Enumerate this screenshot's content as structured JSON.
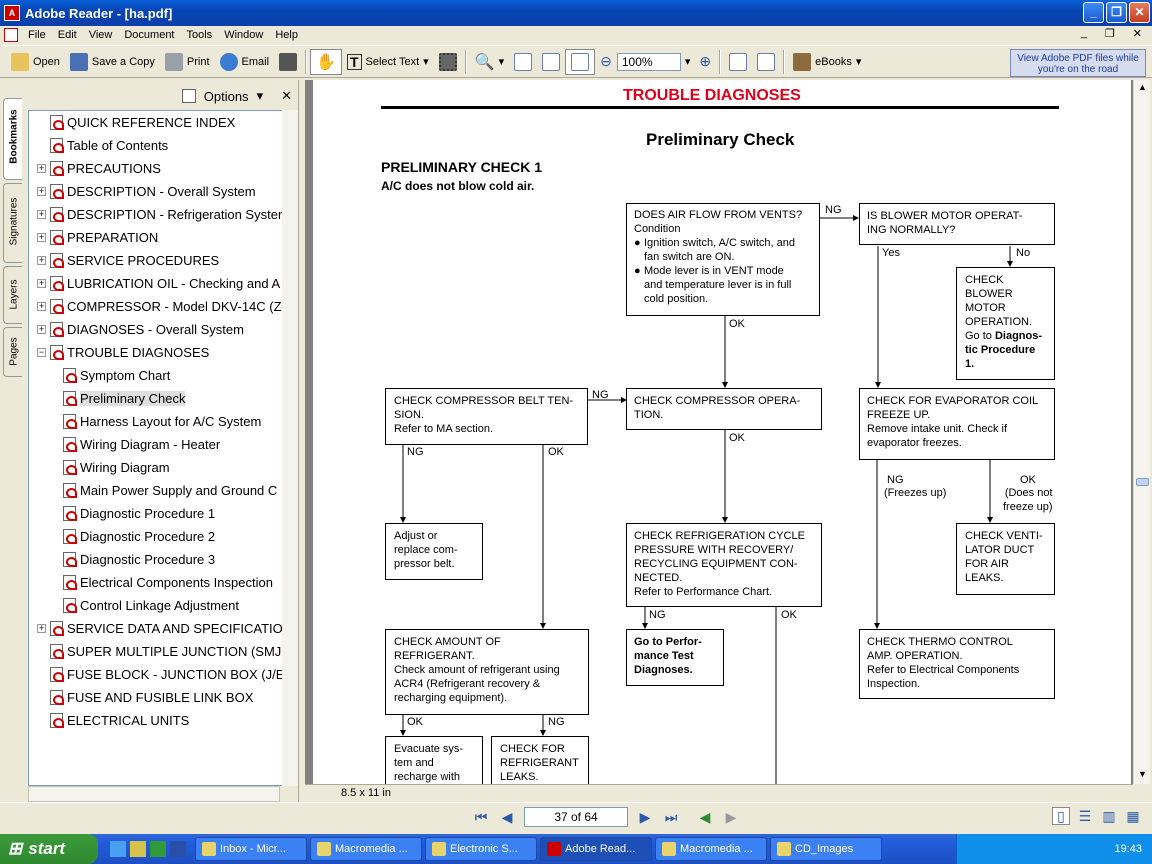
{
  "window": {
    "title": "Adobe Reader - [ha.pdf]"
  },
  "menu": [
    "File",
    "Edit",
    "View",
    "Document",
    "Tools",
    "Window",
    "Help"
  ],
  "toolbar": {
    "open": "Open",
    "save_copy": "Save a Copy",
    "print": "Print",
    "email": "Email",
    "select_text": "Select Text",
    "zoom": "100%",
    "ebooks": "eBooks",
    "banner": "View Adobe PDF files while you're on the road"
  },
  "panel": {
    "options": "Options",
    "tabs": [
      "Bookmarks",
      "Signatures",
      "Layers",
      "Pages"
    ]
  },
  "bookmarks": [
    {
      "label": "QUICK REFERENCE INDEX",
      "level": 0,
      "exp": ""
    },
    {
      "label": "Table of Contents",
      "level": 0,
      "exp": ""
    },
    {
      "label": "PRECAUTIONS",
      "level": 0,
      "exp": "+"
    },
    {
      "label": "DESCRIPTION - Overall System",
      "level": 0,
      "exp": "+"
    },
    {
      "label": "DESCRIPTION - Refrigeration System",
      "level": 0,
      "exp": "+"
    },
    {
      "label": "PREPARATION",
      "level": 0,
      "exp": "+"
    },
    {
      "label": "SERVICE PROCEDURES",
      "level": 0,
      "exp": "+"
    },
    {
      "label": "LUBRICATION OIL - Checking and A",
      "level": 0,
      "exp": "+"
    },
    {
      "label": "COMPRESSOR - Model DKV-14C (Z",
      "level": 0,
      "exp": "+"
    },
    {
      "label": "DIAGNOSES - Overall System",
      "level": 0,
      "exp": "+"
    },
    {
      "label": "TROUBLE DIAGNOSES",
      "level": 0,
      "exp": "-"
    },
    {
      "label": "Symptom Chart",
      "level": 1,
      "exp": ""
    },
    {
      "label": "Preliminary Check",
      "level": 1,
      "exp": "",
      "sel": true
    },
    {
      "label": "Harness Layout for A/C System",
      "level": 1,
      "exp": ""
    },
    {
      "label": "Wiring Diagram - Heater",
      "level": 1,
      "exp": ""
    },
    {
      "label": "Wiring Diagram",
      "level": 1,
      "exp": ""
    },
    {
      "label": "Main Power Supply and Ground C",
      "level": 1,
      "exp": ""
    },
    {
      "label": "Diagnostic Procedure 1",
      "level": 1,
      "exp": ""
    },
    {
      "label": "Diagnostic Procedure 2",
      "level": 1,
      "exp": ""
    },
    {
      "label": "Diagnostic Procedure 3",
      "level": 1,
      "exp": ""
    },
    {
      "label": "Electrical Components Inspection",
      "level": 1,
      "exp": ""
    },
    {
      "label": "Control Linkage Adjustment",
      "level": 1,
      "exp": ""
    },
    {
      "label": "SERVICE DATA AND SPECIFICATIO",
      "level": 0,
      "exp": "+"
    },
    {
      "label": "SUPER MULTIPLE JUNCTION (SMJ",
      "level": 0,
      "exp": ""
    },
    {
      "label": "FUSE BLOCK - JUNCTION BOX (J/E",
      "level": 0,
      "exp": ""
    },
    {
      "label": "FUSE AND FUSIBLE LINK BOX",
      "level": 0,
      "exp": ""
    },
    {
      "label": "ELECTRICAL UNITS",
      "level": 0,
      "exp": ""
    }
  ],
  "doc": {
    "header": "TROUBLE DIAGNOSES",
    "title": "Preliminary Check",
    "subtitle": "PRELIMINARY CHECK 1",
    "symptom": "A/C does not blow cold air.",
    "boxes": {
      "airflow": "DOES AIR FLOW FROM VENTS?\nCondition",
      "airflow_b1": "Ignition switch, A/C switch, and\nfan switch are ON.",
      "airflow_b2": "Mode lever is in VENT mode\nand temperature lever is in full\ncold position.",
      "blower": "IS BLOWER MOTOR OPERAT-\nING NORMALLY?",
      "check_blower": "CHECK\nBLOWER\nMOTOR\nOPERATION.\nGo to ",
      "check_blower_b": "Diagnos-\ntic Procedure\n1.",
      "belt": "CHECK COMPRESSOR BELT TEN-\nSION.\nRefer to MA section.",
      "comp": "CHECK COMPRESSOR OPERA-\nTION.",
      "evap": "CHECK FOR EVAPORATOR COIL\nFREEZE UP.\nRemove intake unit. Check if\nevaporator freezes.",
      "adjust": "Adjust or\nreplace com-\npressor belt.",
      "refcycle": "CHECK REFRIGERATION CYCLE\nPRESSURE WITH RECOVERY/\nRECYCLING EQUIPMENT CON-\nNECTED.\nRefer to Performance Chart.",
      "vent": "CHECK VENTI-\nLATOR DUCT\nFOR AIR\nLEAKS.",
      "amount": "CHECK AMOUNT OF\nREFRIGERANT.\nCheck amount of refrigerant using\nACR4 (Refrigerant recovery &\nrecharging equipment).",
      "perf": "Go to Perfor-\nmance Test\nDiagnoses.",
      "thermo": "CHECK THERMO CONTROL\nAMP. OPERATION.\nRefer to Electrical Components\nInspection.",
      "evacuate": "Evacuate sys-\ntem and\nrecharge with",
      "leaks": "CHECK FOR\nREFRIGERANT\nLEAKS."
    },
    "labels": {
      "ng": "NG",
      "ok": "OK",
      "yes": "Yes",
      "no": "No",
      "freezes": "(Freezes up)",
      "notfreeze": "(Does not\nfreeze up)"
    }
  },
  "status": {
    "page_size": "8.5 x 11 in",
    "page_nav": "37 of 64"
  },
  "taskbar": {
    "start": "start",
    "items": [
      "Inbox - Micr...",
      "Macromedia ...",
      "Electronic S...",
      "Adobe Read...",
      "Macromedia ...",
      "CD_Images"
    ],
    "clock": "19:43"
  }
}
